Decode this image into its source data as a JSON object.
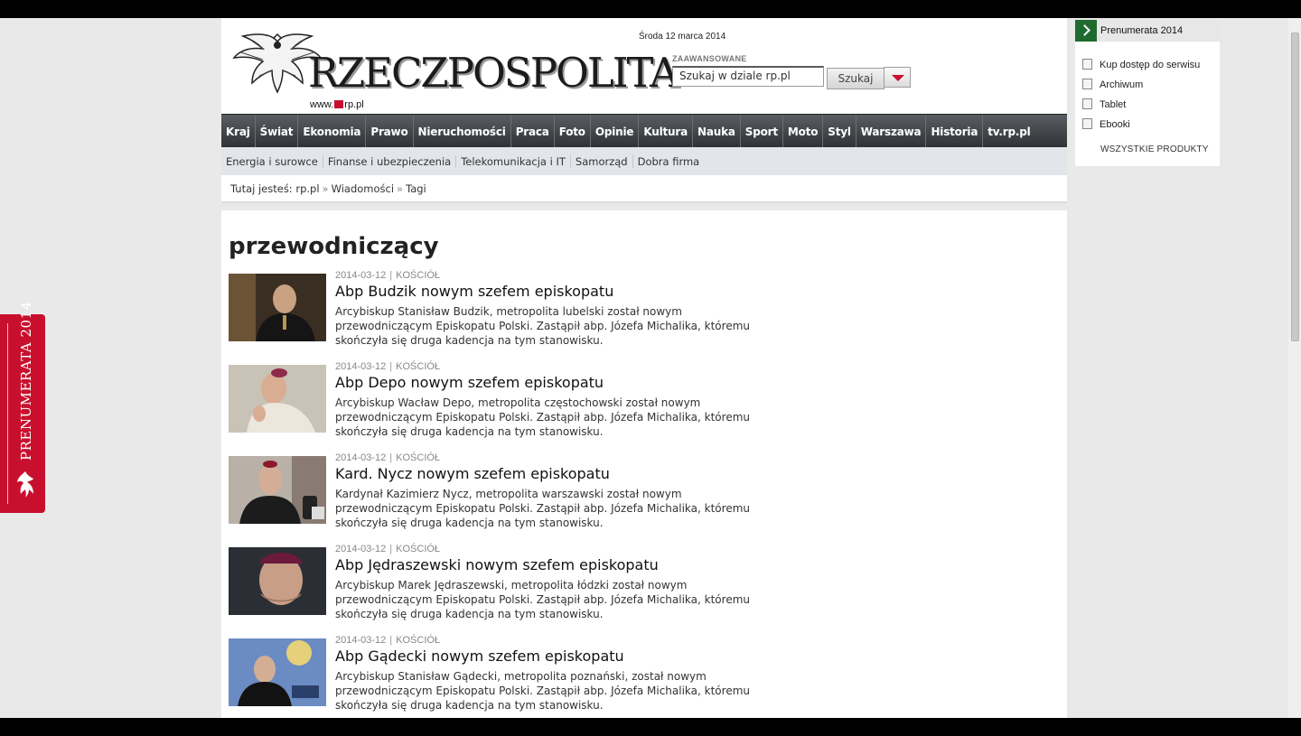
{
  "header": {
    "logo_text": "RZECZPOSPOLITA",
    "logo_url_prefix": "www.",
    "logo_url_suffix": "rp.pl",
    "date": "Środa 12 marca 2014",
    "advanced_label": "ZAAWANSOWANE",
    "search_placeholder": "Szukaj w dziale rp.pl",
    "search_button": "Szukaj"
  },
  "nav": {
    "items": [
      "Kraj",
      "Świat",
      "Ekonomia",
      "Prawo",
      "Nieruchomości",
      "Praca",
      "Foto",
      "Opinie",
      "Kultura",
      "Nauka",
      "Sport",
      "Moto",
      "Styl",
      "Warszawa",
      "Historia",
      "tv.rp.pl"
    ]
  },
  "subnav": {
    "items": [
      "Energia i surowce",
      "Finanse i ubezpieczenia",
      "Telekomunikacja i IT",
      "Samorząd",
      "Dobra firma"
    ]
  },
  "breadcrumb": {
    "prefix": "Tutaj jesteś:",
    "items": [
      "rp.pl",
      "Wiadomości",
      "Tagi"
    ]
  },
  "page": {
    "title": "przewodniczący"
  },
  "articles": [
    {
      "date": "2014-03-12",
      "category": "KOŚCIÓŁ",
      "title": "Abp Budzik nowym szefem episkopatu",
      "lead": "Arcybiskup Stanisław Budzik, metropolita lubelski został nowym przewodniczącym Episkopatu Polski. Zastąpił abp. Józefa Michalika, któremu skończyła się druga kadencja na tym stanowisku."
    },
    {
      "date": "2014-03-12",
      "category": "KOŚCIÓŁ",
      "title": "Abp Depo nowym szefem episkopatu",
      "lead": "Arcybiskup Wacław Depo, metropolita częstochowski został nowym przewodniczącym Episkopatu Polski. Zastąpił abp. Józefa Michalika, któremu skończyła się druga kadencja na tym stanowisku."
    },
    {
      "date": "2014-03-12",
      "category": "KOŚCIÓŁ",
      "title": "Kard. Nycz nowym szefem episkopatu",
      "lead": "Kardynał Kazimierz Nycz, metropolita warszawski został nowym przewodniczącym Episkopatu Polski. Zastąpił abp. Józefa Michalika, któremu skończyła się druga kadencja na tym stanowisku."
    },
    {
      "date": "2014-03-12",
      "category": "KOŚCIÓŁ",
      "title": "Abp Jędraszewski nowym szefem episkopatu",
      "lead": "Arcybiskup Marek Jędraszewski, metropolita łódzki został nowym przewodniczącym Episkopatu Polski. Zastąpił abp. Józefa Michalika, któremu skończyła się druga kadencja na tym stanowisku."
    },
    {
      "date": "2014-03-12",
      "category": "KOŚCIÓŁ",
      "title": "Abp Gądecki nowym szefem episkopatu",
      "lead": "Arcybiskup Stanisław Gądecki, metropolita poznański, został nowym przewodniczącym Episkopatu Polski. Zastąpił abp. Józefa Michalika, któremu skończyła się druga kadencja na tym stanowisku."
    }
  ],
  "sidebar": {
    "header": "Prenumerata 2014",
    "items": [
      "Kup dostęp do serwisu",
      "Archiwum",
      "Tablet",
      "Ebooki"
    ],
    "all_products": "WSZYSTKIE PRODUKTY"
  },
  "promo_tab": {
    "text": "PRENUMERATA 2014"
  },
  "colors": {
    "brand_red": "#c8102e",
    "nav_dark": "#3a3d41",
    "subnav_bg": "#e2e6eb",
    "sidebar_green": "#1f6b2f"
  }
}
